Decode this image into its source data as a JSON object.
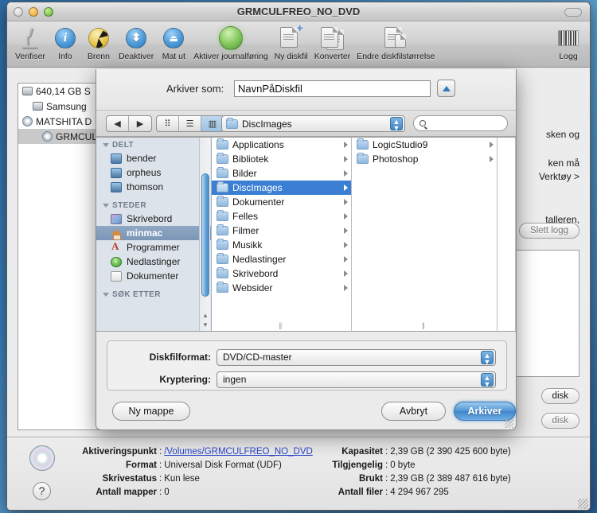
{
  "window": {
    "title": "GRMCULFREO_NO_DVD",
    "traffic_lights": [
      "close",
      "minimize",
      "zoom"
    ]
  },
  "toolbar": {
    "items": [
      {
        "label": "Verifiser",
        "icon": "microscope-icon"
      },
      {
        "label": "Info",
        "icon": "info-icon"
      },
      {
        "label": "Brenn",
        "icon": "burn-radiation-icon"
      },
      {
        "label": "Deaktiver",
        "icon": "unmount-updown-icon"
      },
      {
        "label": "Mat ut",
        "icon": "eject-icon"
      },
      {
        "label": "Aktiver journalføring",
        "icon": "journaling-green-icon"
      },
      {
        "label": "Ny diskfil",
        "icon": "new-disk-image-icon"
      },
      {
        "label": "Konverter",
        "icon": "convert-icon"
      },
      {
        "label": "Endre diskfilstørrelse",
        "icon": "resize-image-icon"
      }
    ],
    "log": {
      "label": "Logg",
      "icon": "log-barcode-icon"
    }
  },
  "disk_list": [
    {
      "label": "640,14 GB S",
      "icon": "hard-disk-icon",
      "indent": 0,
      "selected": false
    },
    {
      "label": "Samsung",
      "icon": "hard-disk-icon",
      "indent": 1,
      "selected": false
    },
    {
      "label": "MATSHITA D",
      "icon": "optical-drive-icon",
      "indent": 0,
      "selected": false
    },
    {
      "label": "GRMCULF",
      "icon": "optical-disc-icon",
      "indent": 2,
      "selected": true
    }
  ],
  "right_panel": {
    "text_fragments": [
      "sken og",
      "ken må",
      "Verktøy >",
      "talleren,"
    ],
    "clear_log_label": "Slett logg",
    "partial_buttons": [
      "disk",
      "disk"
    ]
  },
  "status": {
    "left": [
      {
        "key": "Aktiveringspunkt",
        "value": "/Volumes/GRMCULFREO_NO_DVD",
        "link": true
      },
      {
        "key": "Format",
        "value": "Universal Disk Format (UDF)",
        "link": false
      },
      {
        "key": "Skrivestatus",
        "value": "Kun lese",
        "link": false
      },
      {
        "key": "Antall mapper",
        "value": "0",
        "link": false
      }
    ],
    "right": [
      {
        "key": "Kapasitet",
        "value": "2,39 GB (2 390 425 600 byte)"
      },
      {
        "key": "Tilgjengelig",
        "value": "0 byte"
      },
      {
        "key": "Brukt",
        "value": "2,39 GB (2 389 487 616 byte)"
      },
      {
        "key": "Antall filer",
        "value": "4 294 967 295"
      }
    ],
    "separator": ":",
    "help_glyph": "?",
    "disc_icon": "optical-disc-icon"
  },
  "sheet": {
    "save_as_label": "Arkiver som:",
    "filename_value": "NavnPåDiskfil",
    "filename_placeholder": "Navn",
    "expand_icon": "disclosure-up-icon",
    "nav": {
      "back_icon": "arrow-left-icon",
      "forward_icon": "arrow-right-icon",
      "view_icon": "icon-view-icon",
      "list_icon": "list-view-icon",
      "column_icon": "column-view-icon",
      "path_value": "DiscImages",
      "search_placeholder": ""
    },
    "sidebar": {
      "sections": [
        {
          "header": "DELT",
          "items": [
            {
              "label": "bender",
              "icon": "computer-icon",
              "selected": false
            },
            {
              "label": "orpheus",
              "icon": "computer-icon",
              "selected": false
            },
            {
              "label": "thomson",
              "icon": "computer-icon",
              "selected": false
            }
          ]
        },
        {
          "header": "STEDER",
          "items": [
            {
              "label": "Skrivebord",
              "icon": "desktop-icon",
              "selected": false
            },
            {
              "label": "minmac",
              "icon": "home-icon",
              "selected": true
            },
            {
              "label": "Programmer",
              "icon": "applications-icon",
              "selected": false
            },
            {
              "label": "Nedlastinger",
              "icon": "downloads-icon",
              "selected": false
            },
            {
              "label": "Dokumenter",
              "icon": "documents-icon",
              "selected": false
            }
          ]
        },
        {
          "header": "SØK ETTER",
          "items": []
        }
      ]
    },
    "columns": [
      {
        "items": [
          {
            "label": "Applications",
            "selected": false
          },
          {
            "label": "Bibliotek",
            "selected": false
          },
          {
            "label": "Bilder",
            "selected": false
          },
          {
            "label": "DiscImages",
            "selected": true
          },
          {
            "label": "Dokumenter",
            "selected": false
          },
          {
            "label": "Felles",
            "selected": false
          },
          {
            "label": "Filmer",
            "selected": false
          },
          {
            "label": "Musikk",
            "selected": false
          },
          {
            "label": "Nedlastinger",
            "selected": false
          },
          {
            "label": "Skrivebord",
            "selected": false
          },
          {
            "label": "Websider",
            "selected": false
          }
        ]
      },
      {
        "items": [
          {
            "label": "LogicStudio9",
            "selected": false
          },
          {
            "label": "Photoshop",
            "selected": false
          }
        ]
      },
      {
        "items": []
      }
    ],
    "options": {
      "format_label": "Diskfilformat:",
      "format_value": "DVD/CD-master",
      "encryption_label": "Kryptering:",
      "encryption_value": "ingen"
    },
    "buttons": {
      "new_folder": "Ny mappe",
      "cancel": "Avbryt",
      "save": "Arkiver"
    }
  },
  "colors": {
    "accent_blue": "#3b7fd4",
    "selected_sidebar": "#7b96b6",
    "default_button": "#4e93d4",
    "link": "#2a45c9"
  }
}
